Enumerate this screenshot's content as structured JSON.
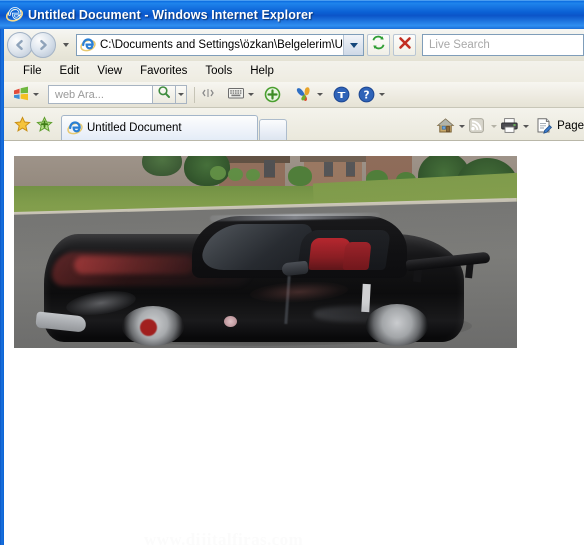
{
  "window": {
    "title": "Untitled Document - Windows Internet Explorer",
    "app_icon": "ie-logo-icon"
  },
  "navbar": {
    "back_label": "◀",
    "forward_label": "▶",
    "recent_pages_icon": "chevron-down-icon",
    "address": {
      "value": "C:\\Documents and Settings\\özkan\\Belgelerim\\Untitled",
      "favicon": "ie-page-icon",
      "dropdown_icon": "chevron-down-icon"
    },
    "refresh_icon": "refresh-icon",
    "stop_icon": "stop-x-icon",
    "search": {
      "placeholder": "Live Search",
      "value": ""
    }
  },
  "menubar": {
    "items": [
      {
        "label": "File"
      },
      {
        "label": "Edit"
      },
      {
        "label": "View"
      },
      {
        "label": "Favorites"
      },
      {
        "label": "Tools"
      },
      {
        "label": "Help"
      }
    ]
  },
  "livebar": {
    "windows_logo_icon": "windows-flag-icon",
    "logo_caret_icon": "chevron-down-icon",
    "search": {
      "placeholder": "web Ara...",
      "value": "",
      "button_icon": "magnifier-icon",
      "dropdown_icon": "chevron-down-icon"
    },
    "grip_icon": "toolbar-grip-icon",
    "keyboard_icon": "onscreen-keyboard-icon",
    "keyboard_caret_icon": "chevron-down-icon",
    "add_icon": "add-plus-icon",
    "messenger_icon": "msn-butterfly-icon",
    "messenger_caret_icon": "chevron-down-icon",
    "mail_icon": "hotmail-icon",
    "help_icon": "help-question-icon",
    "help_caret_icon": "chevron-down-icon"
  },
  "tabbar": {
    "favorites_center_icon": "favorites-star-icon",
    "add_favorite_icon": "add-favorite-star-icon",
    "tabs": [
      {
        "label": "Untitled Document",
        "favicon": "ie-page-icon",
        "active": true
      }
    ],
    "new_tab_label": "",
    "right_tools": {
      "home_icon": "home-icon",
      "home_caret_icon": "chevron-down-icon",
      "feeds_icon": "rss-feed-icon",
      "feeds_caret_icon": "chevron-down-icon",
      "print_icon": "printer-icon",
      "print_caret_icon": "chevron-down-icon",
      "page_icon": "page-menu-icon",
      "page_label": "Page"
    }
  },
  "content": {
    "photo": {
      "alt": "Black Nissan 350Z sports car parked on a suburban street",
      "watermark": "www.dijitalfiras.com"
    }
  },
  "colors": {
    "titlebar_blue": "#0b60d4",
    "chrome_beige": "#ece9de",
    "tab_active": "#eef3fa",
    "accent_green": "#4a9f2f",
    "accent_red": "#c03a2b"
  }
}
